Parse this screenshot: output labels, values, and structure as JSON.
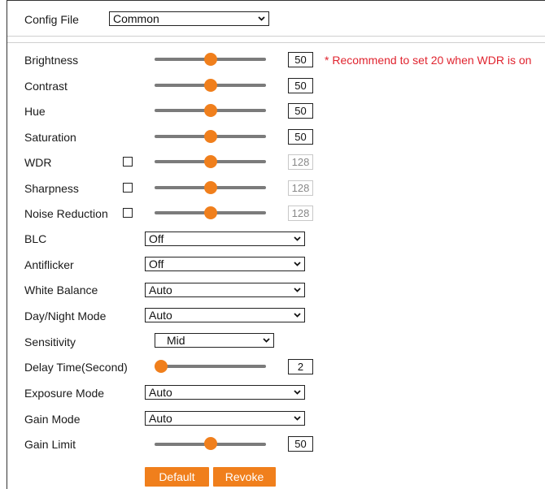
{
  "config_file": {
    "label": "Config File",
    "selected": "Common"
  },
  "sliders": [
    {
      "label": "Brightness",
      "value": 50,
      "min": 0,
      "max": 100,
      "has_checkbox": false,
      "checked": false,
      "enabled": true
    },
    {
      "label": "Contrast",
      "value": 50,
      "min": 0,
      "max": 100,
      "has_checkbox": false,
      "checked": false,
      "enabled": true
    },
    {
      "label": "Hue",
      "value": 50,
      "min": 0,
      "max": 100,
      "has_checkbox": false,
      "checked": false,
      "enabled": true
    },
    {
      "label": "Saturation",
      "value": 50,
      "min": 0,
      "max": 100,
      "has_checkbox": false,
      "checked": false,
      "enabled": true
    },
    {
      "label": "WDR",
      "value": 128,
      "min": 0,
      "max": 255,
      "has_checkbox": true,
      "checked": false,
      "enabled": false
    },
    {
      "label": "Sharpness",
      "value": 128,
      "min": 0,
      "max": 255,
      "has_checkbox": true,
      "checked": false,
      "enabled": false
    },
    {
      "label": "Noise Reduction",
      "value": 128,
      "min": 0,
      "max": 255,
      "has_checkbox": true,
      "checked": false,
      "enabled": false
    }
  ],
  "brightness_hint": "* Recommend to set 20 when WDR is on",
  "selects": [
    {
      "label": "BLC",
      "selected": "Off"
    },
    {
      "label": "Antiflicker",
      "selected": "Off"
    },
    {
      "label": "White Balance",
      "selected": "Auto"
    },
    {
      "label": "Day/Night Mode",
      "selected": "Auto"
    },
    {
      "label": "Sensitivity",
      "selected": "Mid"
    }
  ],
  "delay_time": {
    "label": "Delay Time(Second)",
    "value": 2,
    "min": 2,
    "max": 60
  },
  "selects2": [
    {
      "label": "Exposure Mode",
      "selected": "Auto"
    },
    {
      "label": "Gain Mode",
      "selected": "Auto"
    }
  ],
  "gain_limit": {
    "label": "Gain Limit",
    "value": 50,
    "min": 0,
    "max": 100
  },
  "buttons": {
    "default": "Default",
    "revoke": "Revoke"
  },
  "colors": {
    "accent": "#f07f1c",
    "hint": "#e0242f"
  }
}
